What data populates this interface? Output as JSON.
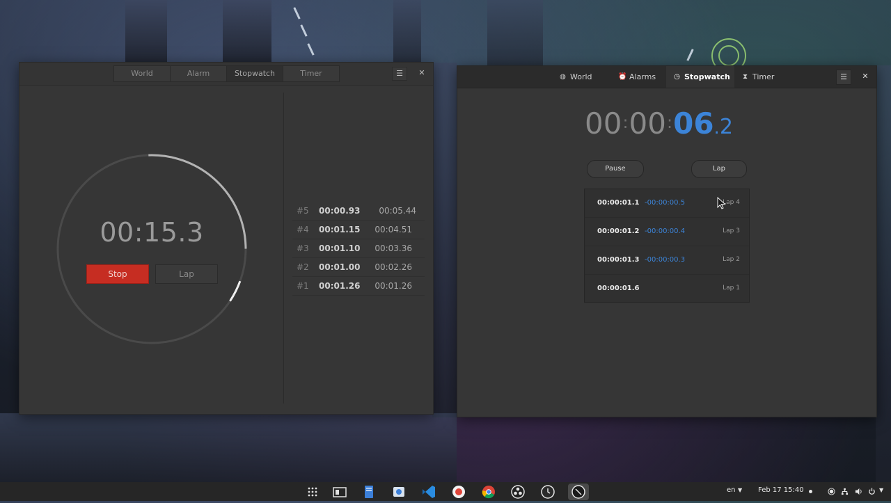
{
  "left_window": {
    "tabs": [
      {
        "label": "World"
      },
      {
        "label": "Alarm"
      },
      {
        "label": "Stopwatch"
      },
      {
        "label": "Timer"
      }
    ],
    "active_tab": "Stopwatch",
    "menu_icon": "hamburger-icon",
    "close_icon": "close-icon",
    "time": "00:15.3",
    "ring_progress": 0.255,
    "stop_label": "Stop",
    "lap_label": "Lap",
    "laps": [
      {
        "num": "#5",
        "split": "00:00.93",
        "total": "00:05.44"
      },
      {
        "num": "#4",
        "split": "00:01.15",
        "total": "00:04.51"
      },
      {
        "num": "#3",
        "split": "00:01.10",
        "total": "00:03.36"
      },
      {
        "num": "#2",
        "split": "00:01.00",
        "total": "00:02.26"
      },
      {
        "num": "#1",
        "split": "00:01.26",
        "total": "00:01.26"
      }
    ]
  },
  "right_window": {
    "tabs": [
      {
        "label": "World",
        "icon": "globe-icon"
      },
      {
        "label": "Alarms",
        "icon": "alarm-clock-icon"
      },
      {
        "label": "Stopwatch",
        "icon": "stopwatch-icon"
      },
      {
        "label": "Timer",
        "icon": "hourglass-icon"
      }
    ],
    "active_tab": "Stopwatch",
    "time": {
      "hours": "00",
      "minutes": "00",
      "seconds": "06",
      "tenths": "2",
      "separator": ":",
      "decimal": "."
    },
    "pause_label": "Pause",
    "lap_label": "Lap",
    "laps": [
      {
        "time": "00:00:01.1",
        "diff": "-00:00:00.5",
        "label": "Lap 4"
      },
      {
        "time": "00:00:01.2",
        "diff": "-00:00:00.4",
        "label": "Lap 3"
      },
      {
        "time": "00:00:01.3",
        "diff": "-00:00:00.3",
        "label": "Lap 2"
      },
      {
        "time": "00:00:01.6",
        "diff": "",
        "label": "Lap 1"
      }
    ],
    "accent_color": "#3c84d8"
  },
  "taskbar": {
    "apps": [
      {
        "name": "app-grid-icon"
      },
      {
        "name": "file-manager-icon"
      },
      {
        "name": "text-editor-icon"
      },
      {
        "name": "screenshot-icon"
      },
      {
        "name": "vscode-icon"
      },
      {
        "name": "software-center-icon"
      },
      {
        "name": "chrome-icon"
      },
      {
        "name": "obs-icon"
      },
      {
        "name": "clocks-icon"
      },
      {
        "name": "clocks-dark-icon"
      }
    ],
    "keyboard_layout": "en",
    "datetime": "Feb 17  15:40",
    "tray_icons": [
      "night-light-icon",
      "network-icon",
      "volume-icon",
      "power-icon"
    ]
  }
}
